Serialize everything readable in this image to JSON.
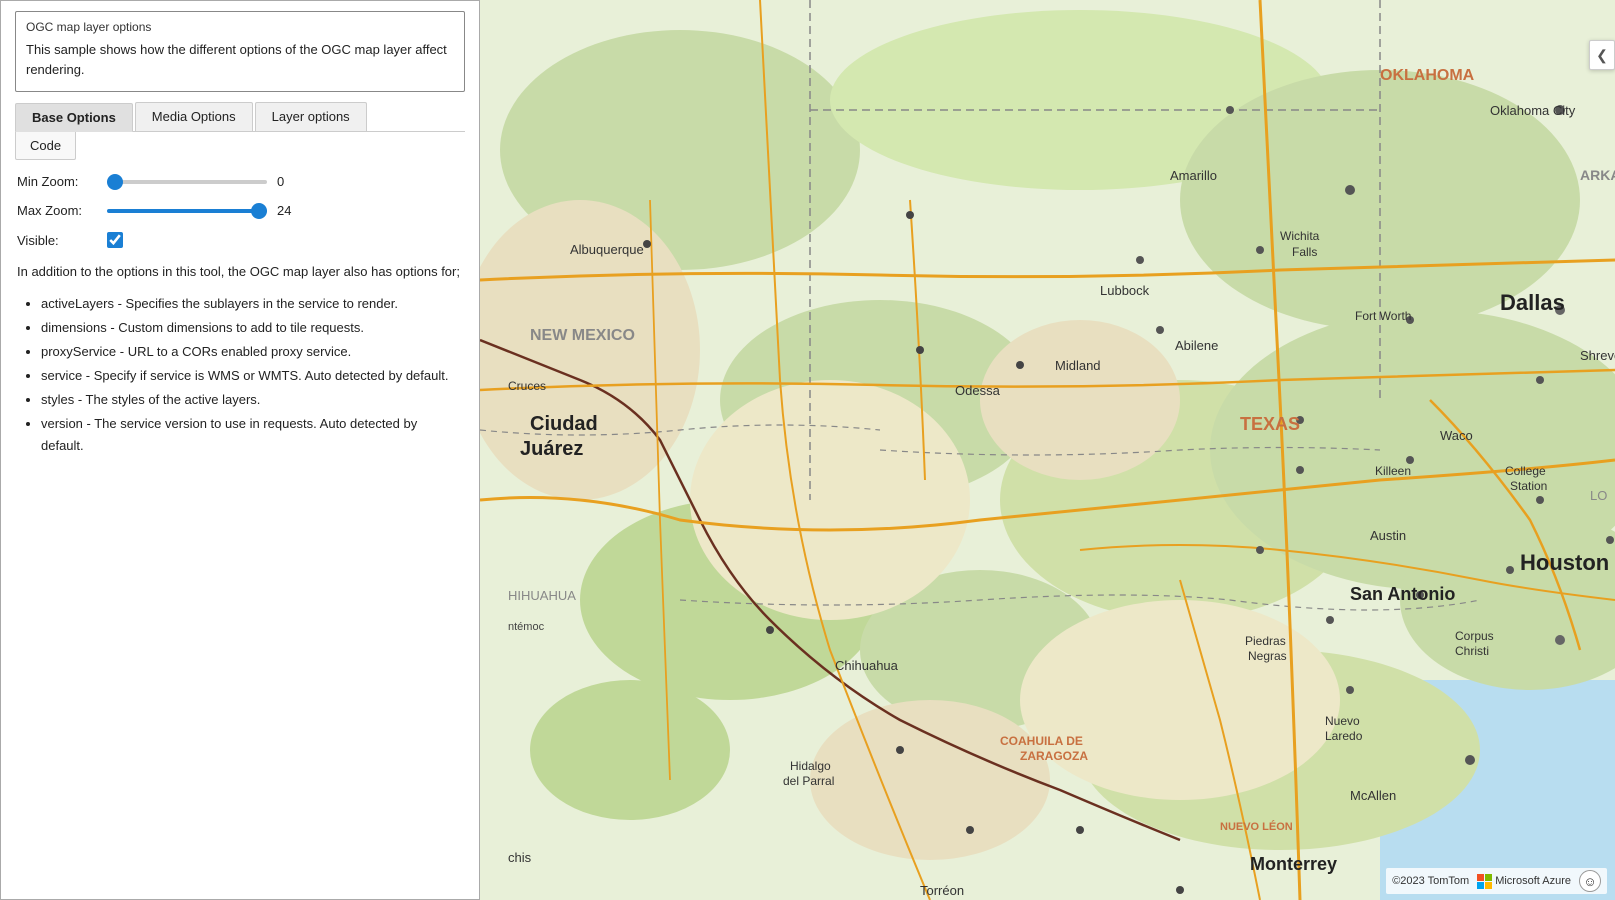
{
  "panel": {
    "title": "OGC map layer options",
    "description": "This sample shows how the different options of the OGC map layer affect rendering.",
    "tabs": [
      {
        "id": "base",
        "label": "Base Options",
        "active": true
      },
      {
        "id": "media",
        "label": "Media Options",
        "active": false
      },
      {
        "id": "layer",
        "label": "Layer options",
        "active": false
      }
    ],
    "code_tab_label": "Code",
    "controls": {
      "min_zoom_label": "Min Zoom:",
      "min_zoom_value": 0,
      "min_zoom_min": 0,
      "min_zoom_max": 24,
      "max_zoom_label": "Max Zoom:",
      "max_zoom_value": 24,
      "max_zoom_min": 0,
      "max_zoom_max": 24,
      "visible_label": "Visible:",
      "visible_checked": true
    },
    "info_text": "In addition to the options in this tool, the OGC map layer also has options for;",
    "bullets": [
      "activeLayers - Specifies the sublayers in the service to render.",
      "dimensions - Custom dimensions to add to tile requests.",
      "proxyService - URL to a CORs enabled proxy service.",
      "service - Specify if service is WMS or WMTS. Auto detected by default.",
      "styles - The styles of the active layers.",
      "version - The service version to use in requests. Auto detected by default."
    ]
  },
  "map": {
    "attribution": "©2023 TomTom",
    "brand": "Microsoft Azure",
    "collapse_icon": "❮",
    "smiley_icon": "☺"
  },
  "colors": {
    "accent_blue": "#1a7fd4",
    "tab_active_bg": "#e0e0e0",
    "tab_inactive_bg": "#f0f0f0"
  }
}
